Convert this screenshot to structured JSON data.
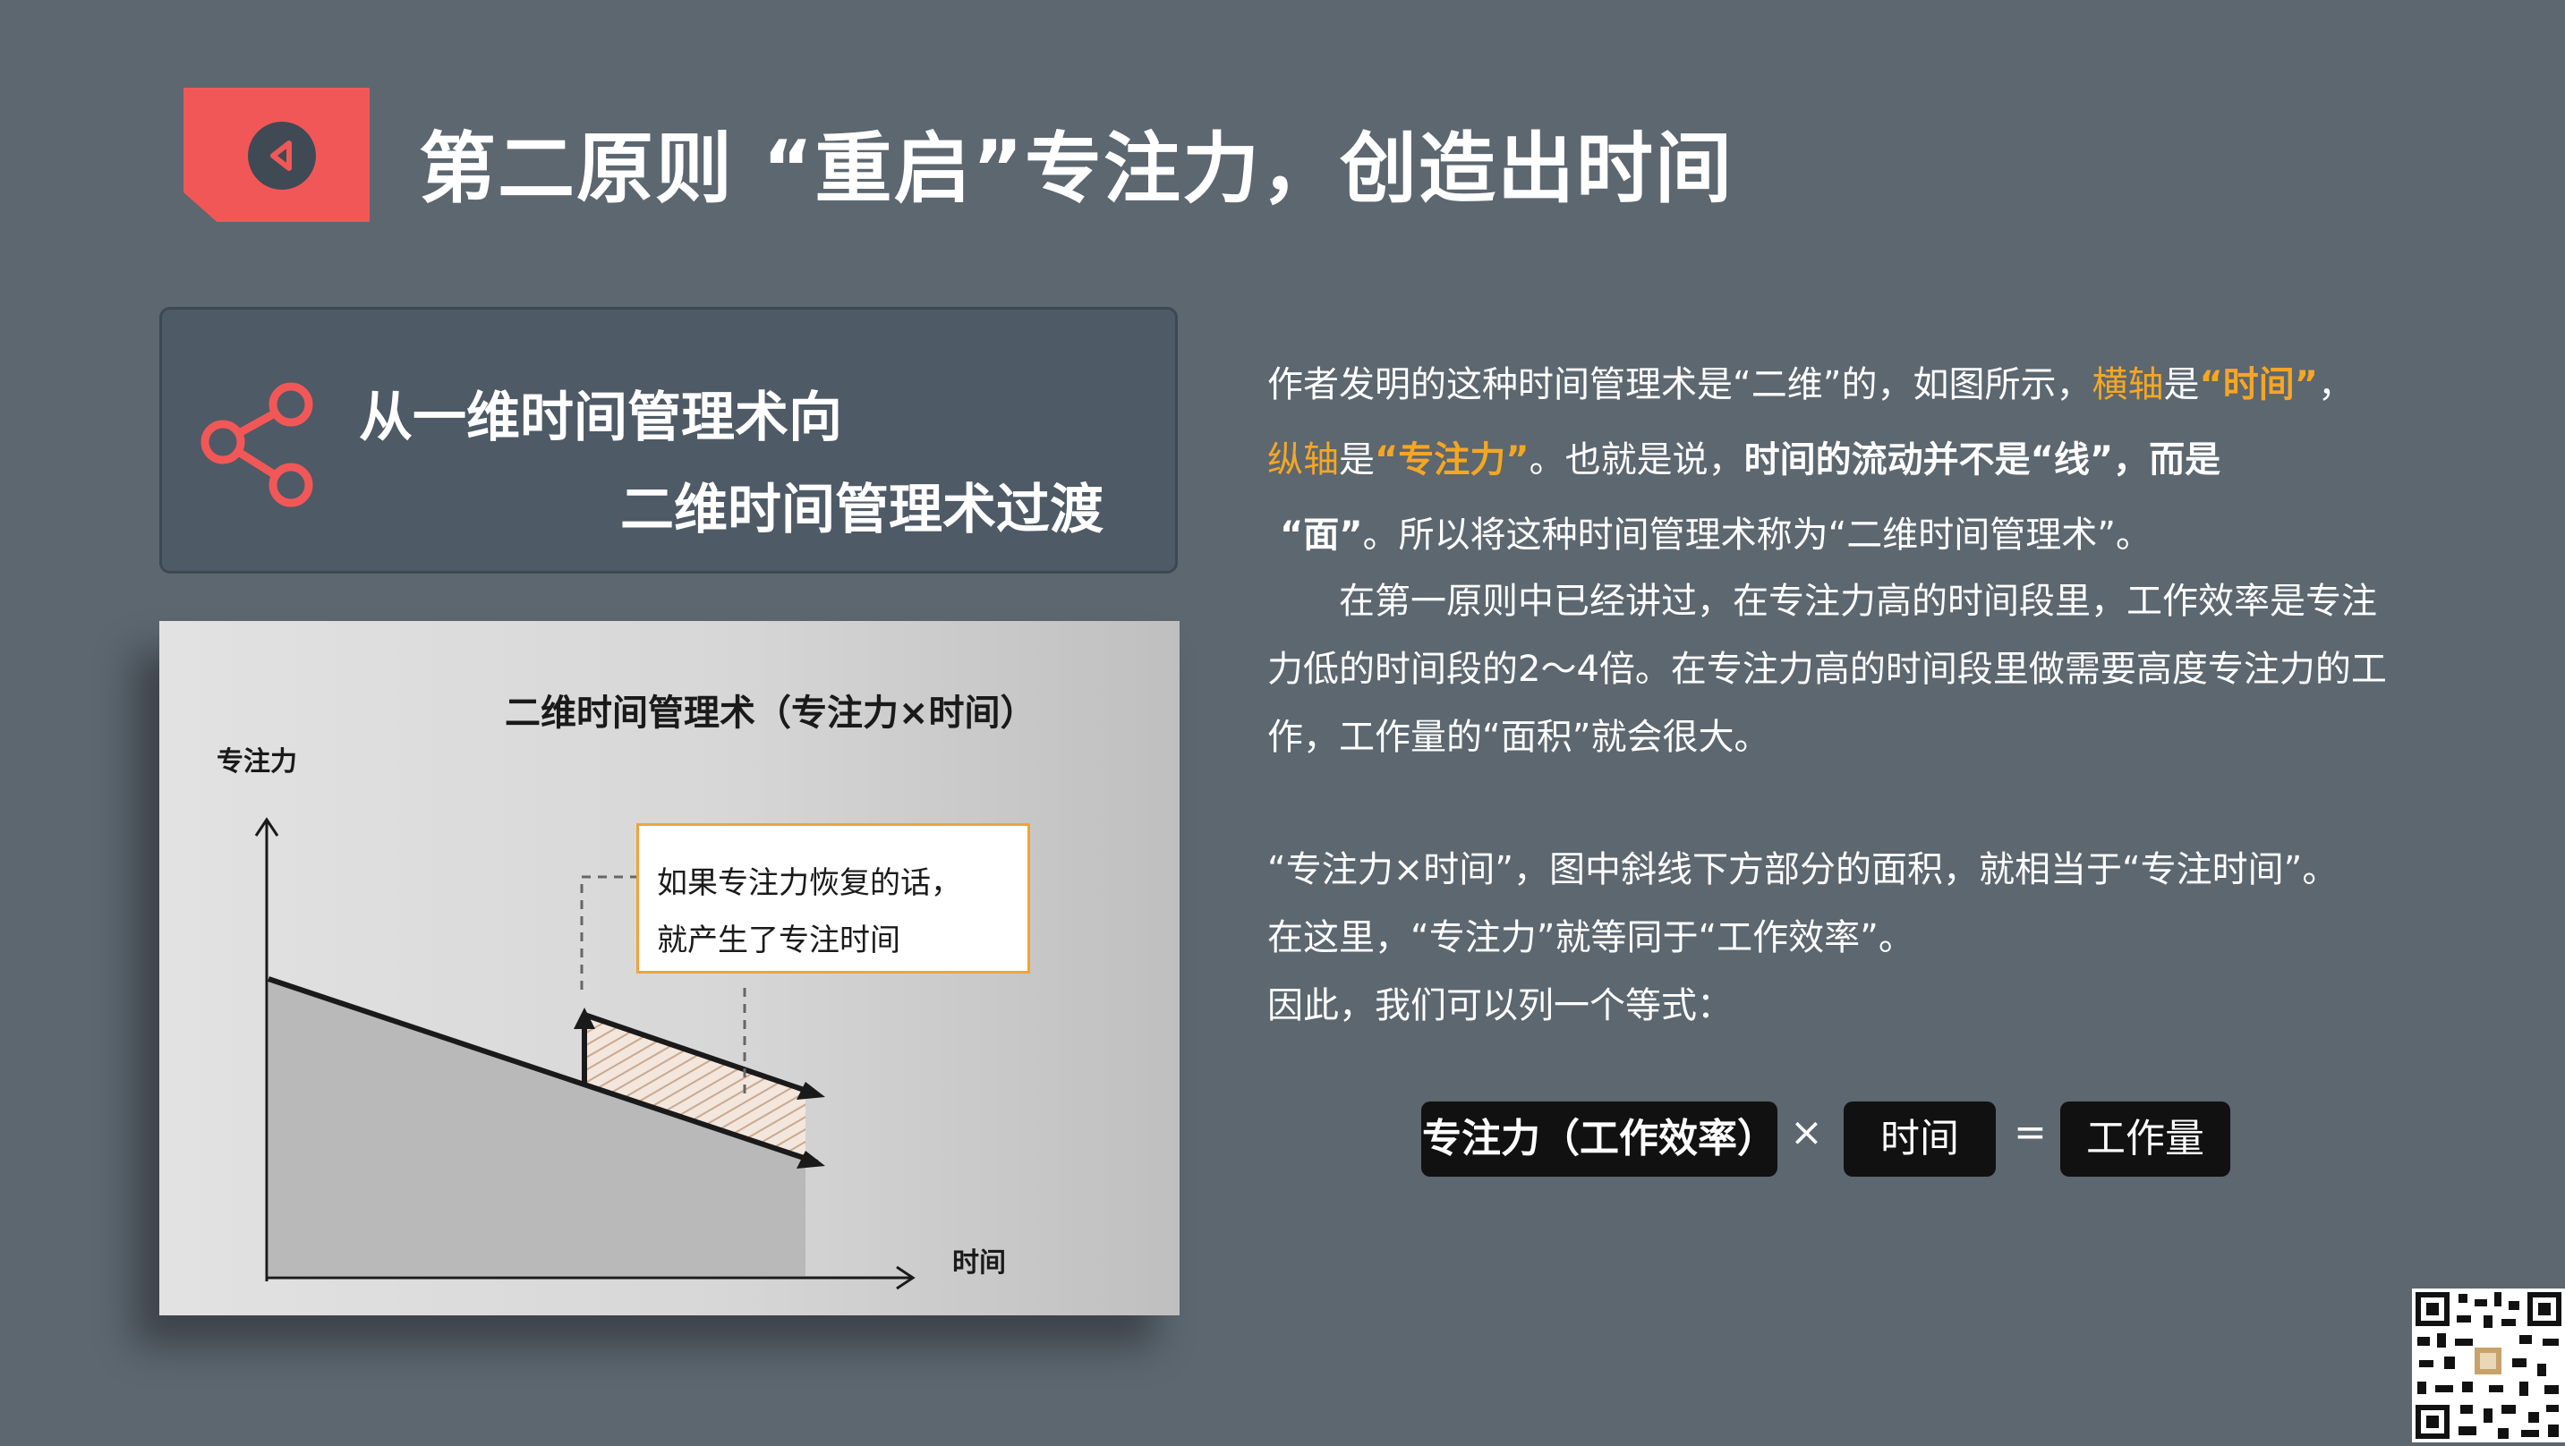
{
  "title": {
    "text": "第二原则 “重启”专注力，创造出时间",
    "badge_color": "#f25757",
    "badge_icon": "back-arrow-icon"
  },
  "subheading": {
    "line1": "从一维时间管理术向",
    "line2": "二维时间管理术过渡",
    "icon": "share-icon",
    "icon_color": "#f25757"
  },
  "figure": {
    "title": "二维时间管理术（专注力×时间）",
    "y_label": "专注力",
    "x_label": "时间",
    "callout_line1": "如果专注力恢复的话，",
    "callout_line2": "就产生了专注时间",
    "callout_border_color": "#f0a33a"
  },
  "body": {
    "p1_s1": "作者发明的这种时间管理术是“二维”的，如图所示，",
    "p1_s2": "横轴",
    "p1_s3": "是",
    "p1_s4": "“时间”",
    "p1_s5": "，",
    "p1_s6": "纵轴",
    "p1_s7": "是",
    "p1_s8": "“专注力”",
    "p1_s9": "。也就是说，",
    "p1_s10": "时间的流动并不是“线”，而是",
    "p1_s11": "“面”",
    "p1_s12": "。所以将这种时间管理术称为“二维时间管理术”。",
    "p2_l1": "在第一原则中已经讲过，在专注力高的时间段里，工作效率是专注",
    "p2_l2": "力低的时间段的2～4倍。在专注力高的时间段里做需要高度专注力的工",
    "p2_l3": "作，工作量的“面积”就会很大。",
    "p3_l1": "“专注力×时间”，图中斜线下方部分的面积，就相当于“专注时间”。",
    "p3_l2": "在这里，“专注力”就等同于“工作效率”。",
    "p3_l3": "因此，我们可以列一个等式："
  },
  "equation": {
    "term1": "专注力（工作效率）",
    "times": "×",
    "term2": "时间",
    "equals": "=",
    "result": "工作量"
  },
  "qr_icon": "qr-code-icon"
}
